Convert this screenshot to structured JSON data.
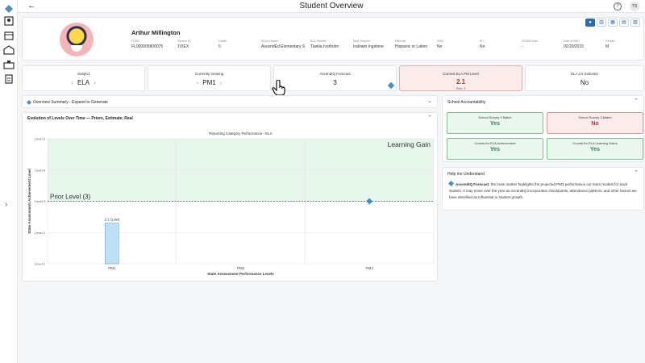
{
  "header": {
    "title": "Student Overview",
    "user_initials": "TS",
    "help": "?"
  },
  "rail": {
    "expand": "›"
  },
  "profile": {
    "name": "Arthur Millington",
    "view_toggles": [
      "person-icon",
      "chart-icon",
      "grid-icon",
      "calendar-icon",
      "table-icon"
    ],
    "fields": [
      {
        "label": "FLEID",
        "value": "FL000005800075"
      },
      {
        "label": "Student ID",
        "value": "1VIEX"
      },
      {
        "label": "Grade",
        "value": "5"
      },
      {
        "label": "School Name",
        "value": "AscendEd Elementary S"
      },
      {
        "label": "ELA Teacher",
        "value": "Tiastia Ivorholm"
      },
      {
        "label": "Math Teacher",
        "value": "Iralowin Ingstone"
      },
      {
        "label": "Ethnicity",
        "value": "Hispanic or Latino"
      },
      {
        "label": "SWD",
        "value": "No"
      },
      {
        "label": "ELL",
        "value": "No"
      },
      {
        "label": "CE/505 Date",
        "value": "-"
      },
      {
        "label": "Date of Birth",
        "value": "02/20/2015"
      },
      {
        "label": "Gender",
        "value": "M"
      }
    ]
  },
  "cards": {
    "subject": {
      "label": "Subject",
      "value": "ELA"
    },
    "viewing": {
      "label": "Currently Viewing",
      "value": "PM1"
    },
    "forecast": {
      "label": "AscendIQ Forecast",
      "value": "3"
    },
    "current": {
      "label": "Current ELA PM Level",
      "value": "2.1",
      "sub": "Prior: 3"
    },
    "lg": {
      "label": "ELA LG Indicator",
      "value": "No"
    }
  },
  "overview": {
    "title": "Overview Summary - Expand to Generate"
  },
  "evolution": {
    "title": "Evolution of Levels Over Time — Priors, Estimate, Real"
  },
  "chart_data": {
    "type": "bar",
    "title": "Reporting Category Performance - ELA",
    "xlabel": "State Assessment Performance Levels",
    "ylabel": "State Assessment Achievement Level",
    "categories": [
      "PM1",
      "PM2",
      "PM3"
    ],
    "y_ticks": [
      "Level 1",
      "Level 2",
      "Level 3",
      "Level 4",
      "Level 5"
    ],
    "ylim": [
      1,
      5
    ],
    "bar": {
      "category": "PM1",
      "value": 2.3,
      "label": "2.1 (Low)"
    },
    "forecast_point": {
      "category": "PM3",
      "value": 3
    },
    "prior_line": {
      "value": 3,
      "label": "Prior Level (3)"
    },
    "shaded_region": {
      "from": 3,
      "to": 5,
      "label": "Learning Gain"
    },
    "grid": true,
    "colors": {
      "bar": "#bfe0f7",
      "bar_stroke": "#63a7d6",
      "region": "#e6f6ea",
      "point": "#3d8fc9"
    }
  },
  "accountability": {
    "title": "School Accountability",
    "items": [
      {
        "label": "School Survey 2 Match",
        "value": "Yes",
        "status": "green"
      },
      {
        "label": "School Survey 3 Match",
        "value": "No",
        "status": "red"
      },
      {
        "label": "Counts for ELA Achievement",
        "value": "Yes",
        "status": "green"
      },
      {
        "label": "Counts for ELA Learning Gains",
        "value": "Yes",
        "status": "green"
      }
    ]
  },
  "help": {
    "title": "Help me Understand",
    "lead": "AscendIQ Forecast:",
    "body": " the brain marker highlights the projected PM3 performance our team models for each student. It may move over the year as AscendIQ incorporates checkpoints, attendance patterns, and other factors we have identified as influential to student growth."
  }
}
